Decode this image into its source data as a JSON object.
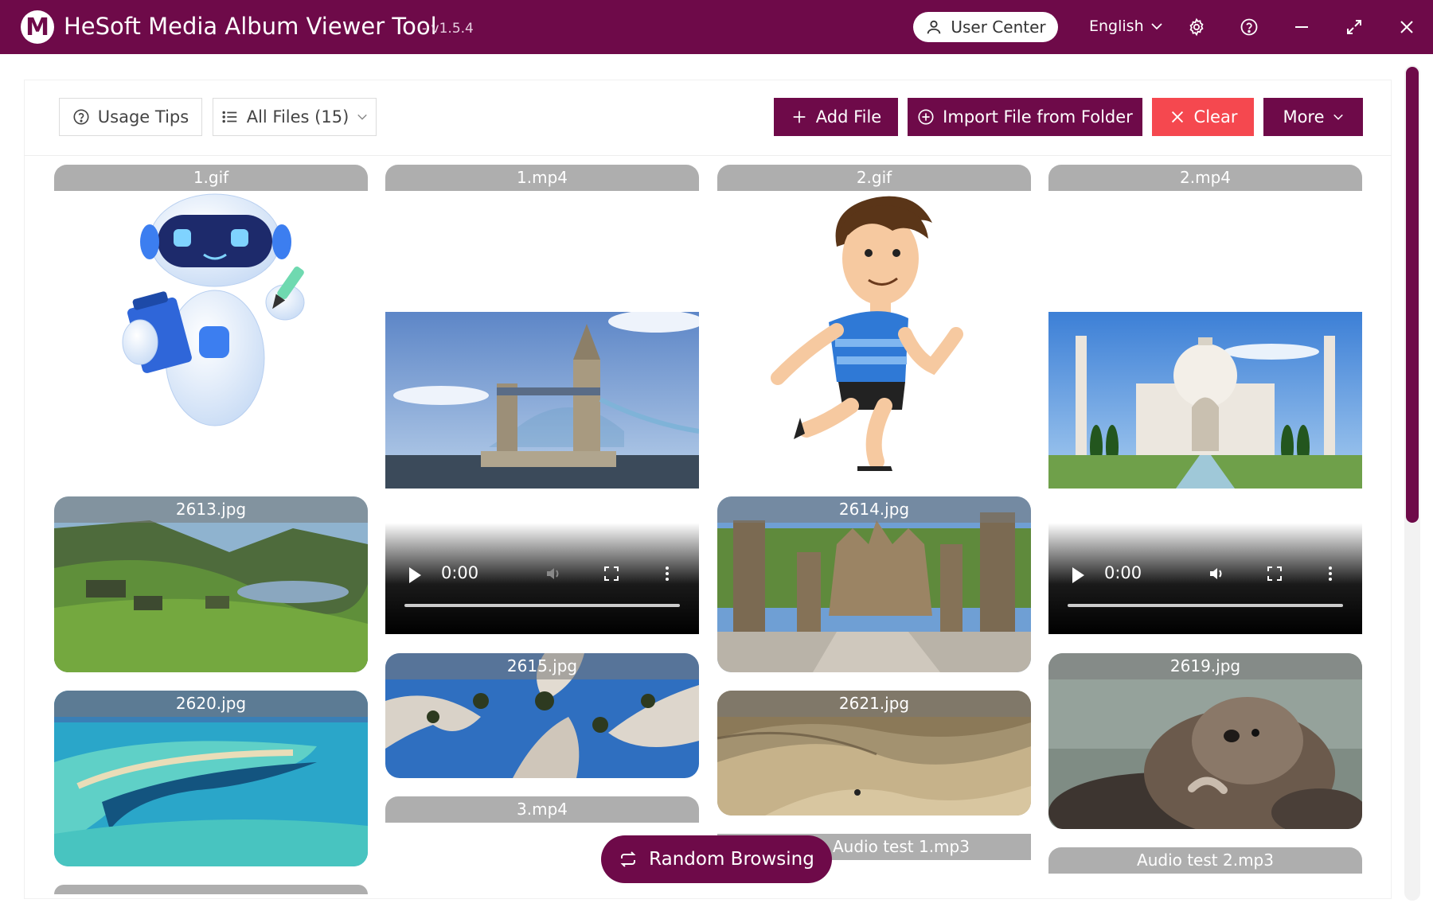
{
  "titlebar": {
    "logo_letter": "M",
    "title": "HeSoft Media Album Viewer Tool",
    "version": "- v1.5.4",
    "user_center": "User Center",
    "language": "English"
  },
  "toolbar": {
    "usage_tips": "Usage Tips",
    "all_files": "All Files (15)",
    "add_file": "Add File",
    "import_folder": "Import File from Folder",
    "clear": "Clear",
    "more": "More"
  },
  "files": {
    "f1": "1.gif",
    "f2": "1.mp4",
    "f3": "2.gif",
    "f4": "2.mp4",
    "f5": "2613.jpg",
    "f6": "2614.jpg",
    "f7": "2620.jpg",
    "f8": "2615.jpg",
    "f9": "2621.jpg",
    "f10": "2619.jpg",
    "f11": "3.mp4",
    "f12": "Audio test 1.mp3",
    "f13": "Audio test 2.mp3"
  },
  "video": {
    "time1": "0:00",
    "time2": "0:00"
  },
  "random_browsing": "Random Browsing",
  "colors": {
    "brand": "#6e0a49",
    "danger": "#f5484f"
  }
}
